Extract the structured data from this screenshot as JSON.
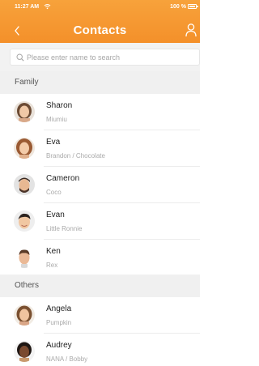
{
  "status_bar": {
    "time": "11:27 AM",
    "battery_text": "100 %"
  },
  "header": {
    "title": "Contacts"
  },
  "search": {
    "placeholder": "Please enter name to search"
  },
  "sections": [
    {
      "title": "Family",
      "contacts": [
        {
          "name": "Sharon",
          "sub": "Miumiu"
        },
        {
          "name": "Eva",
          "sub": "Brandon / Chocolate"
        },
        {
          "name": "Cameron",
          "sub": "Coco"
        },
        {
          "name": "Evan",
          "sub": "Little Ronnie"
        },
        {
          "name": "Ken",
          "sub": "Rex"
        }
      ]
    },
    {
      "title": "Others",
      "contacts": [
        {
          "name": "Angela",
          "sub": "Pumpkin"
        },
        {
          "name": "Audrey",
          "sub": "NANA / Bobby"
        }
      ]
    }
  ],
  "colors": {
    "accent": "#f4902a",
    "section_bg": "#f0f0f0"
  },
  "icons": {
    "back": "chevron-left-icon",
    "user": "person-icon",
    "search": "search-icon"
  }
}
